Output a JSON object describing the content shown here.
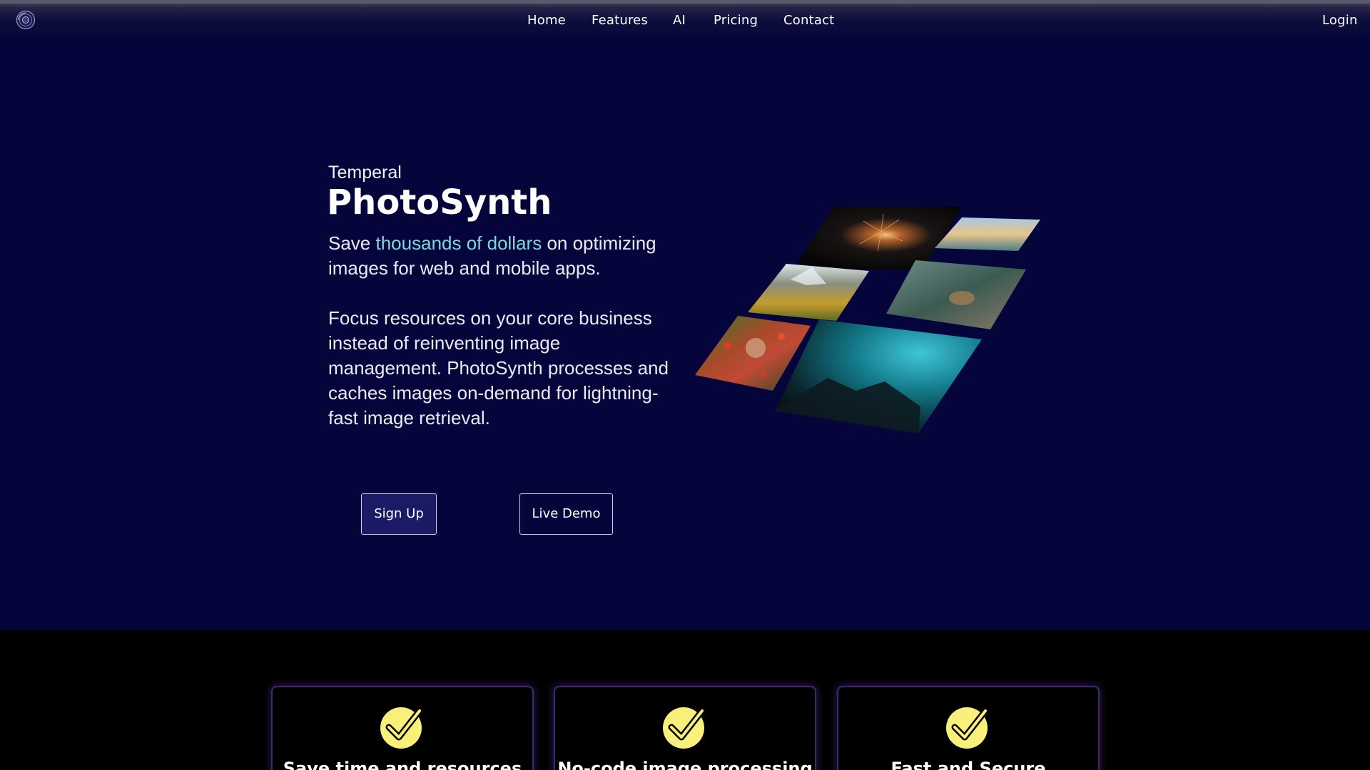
{
  "header": {
    "logo_icon": "orb-logo-icon",
    "nav": [
      {
        "label": "Home"
      },
      {
        "label": "Features"
      },
      {
        "label": "AI"
      },
      {
        "label": "Pricing"
      },
      {
        "label": "Contact"
      }
    ],
    "login_label": "Login"
  },
  "hero": {
    "brand": "Temperal",
    "product": "PhotoSynth",
    "tagline_before": "Save ",
    "tagline_highlight": "thousands of dollars",
    "tagline_after": " on optimizing images for web and mobile apps.",
    "description": "Focus resources on your core business instead of reinventing image management. PhotoSynth processes and caches images on-demand for lightning-fast image retrieval.",
    "signup_label": "Sign Up",
    "demo_label": "Live Demo",
    "mosaic_images": [
      "fireworks-photo",
      "waterfront-city-photo",
      "mountain-valley-photo",
      "deer-in-forest-photo",
      "woman-with-flowers-photo",
      "night-sky-landscape-photo"
    ]
  },
  "features": {
    "cards": [
      {
        "icon": "check-badge-icon",
        "title": "Save time and resources"
      },
      {
        "icon": "check-badge-icon",
        "title": "No-code image processing"
      },
      {
        "icon": "check-badge-icon",
        "title": "Fast and Secure"
      }
    ]
  },
  "colors": {
    "hero_bg": "#05053c",
    "highlight": "#7fd6dc",
    "check_yellow": "#f8f07a",
    "card_border": "#3e2a66"
  }
}
